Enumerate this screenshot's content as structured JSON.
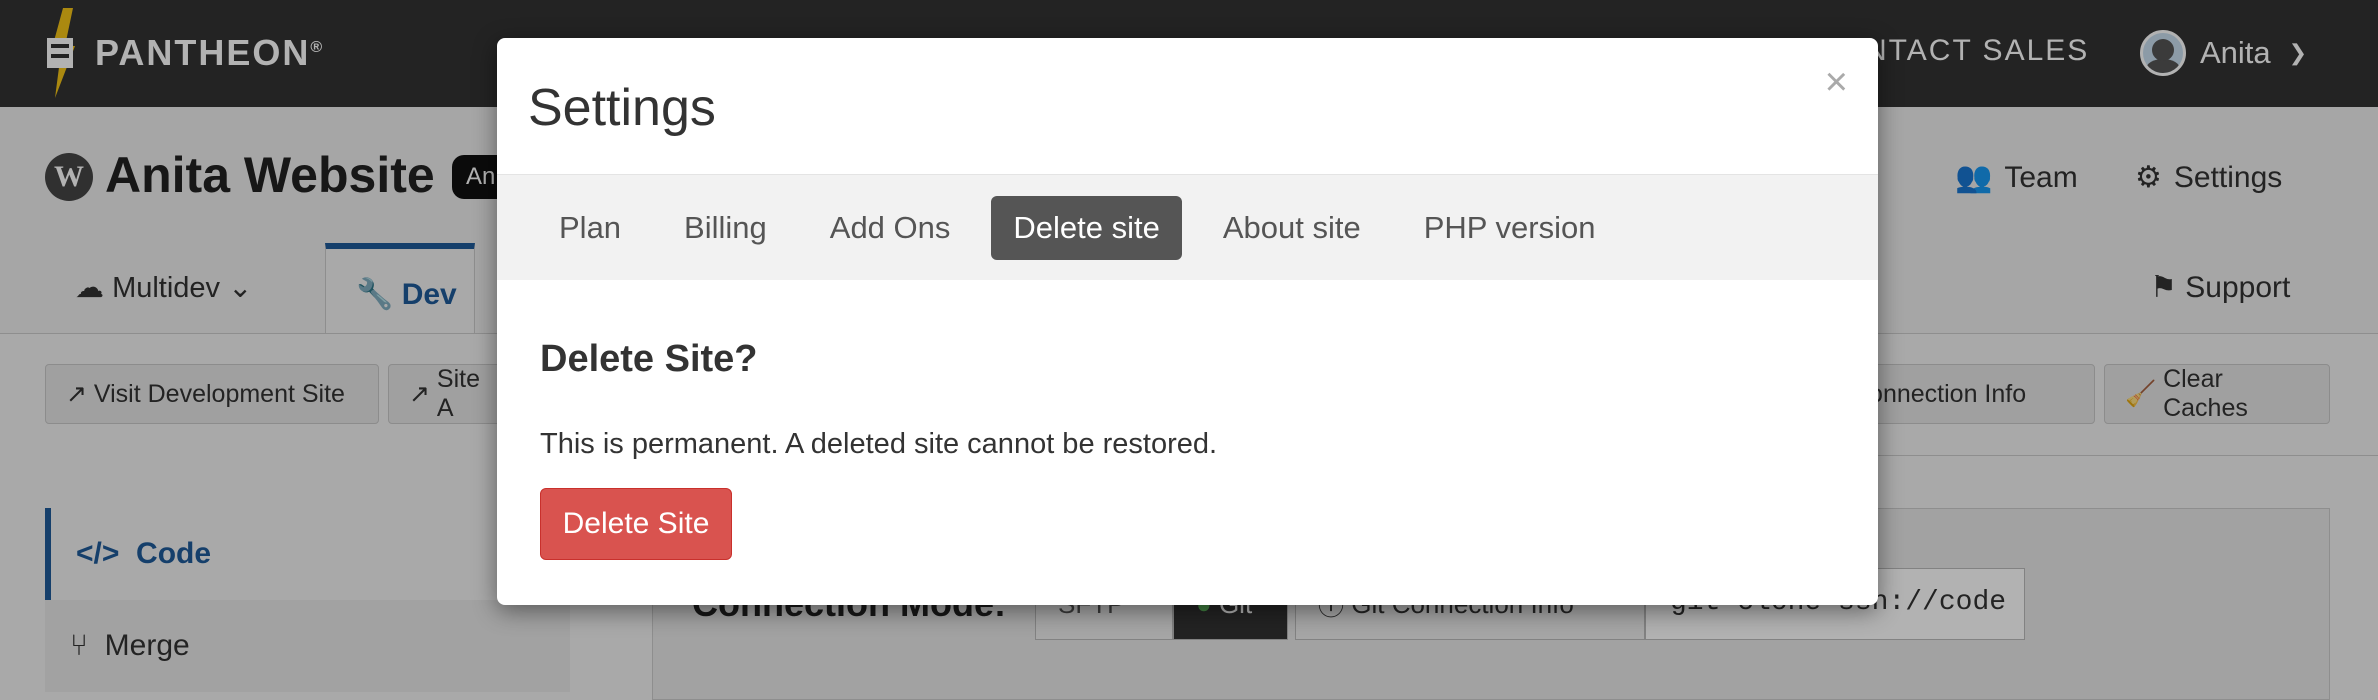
{
  "topbar": {
    "brand": "PANTHEON",
    "brand_mark": "®",
    "contact": "CONTACT SALES",
    "contact_visible": "NTACT SALES",
    "user_name": "Anita"
  },
  "site": {
    "wp_glyph": "W",
    "title": "Anita Website",
    "badge": "An",
    "team": "Team",
    "settings": "Settings"
  },
  "env_tabs": {
    "multidev": "Multidev",
    "dev": "Dev",
    "support": "Support"
  },
  "toolbar": {
    "visit": "Visit Development Site",
    "site_admin": "Site A",
    "connection_info": "Connection Info",
    "clear_caches": "Clear Caches"
  },
  "sidebar": {
    "items": [
      {
        "label": "Code",
        "icon": "code-icon"
      },
      {
        "label": "Merge",
        "icon": "merge-icon"
      }
    ]
  },
  "connection": {
    "label": "Connection Mode:",
    "sftp": "SFTP",
    "git": "Git",
    "git_info": "Git Connection Info",
    "clone": "git clone ssh://code"
  },
  "modal": {
    "title": "Settings",
    "close": "×",
    "tabs": [
      {
        "label": "Plan"
      },
      {
        "label": "Billing"
      },
      {
        "label": "Add Ons"
      },
      {
        "label": "Delete site",
        "active": true
      },
      {
        "label": "About site"
      },
      {
        "label": "PHP version"
      }
    ],
    "heading": "Delete Site?",
    "text": "This is permanent. A deleted site cannot be restored.",
    "button": "Delete Site"
  },
  "colors": {
    "accent": "#1f5b9a",
    "danger": "#d9534f",
    "topbar": "#333333",
    "brand_yellow": "#f5c518"
  }
}
